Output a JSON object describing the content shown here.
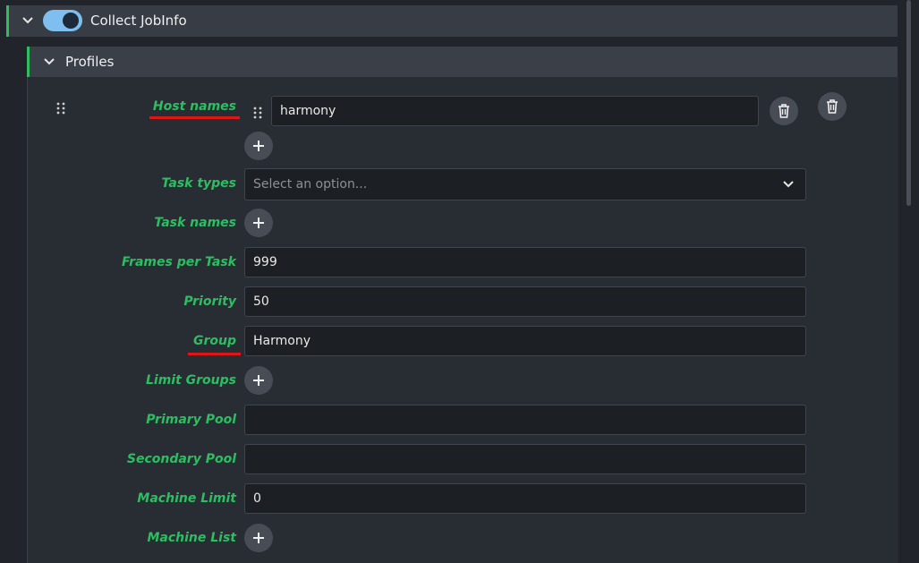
{
  "header": {
    "title": "Collect JobInfo",
    "enabled": true
  },
  "profiles": {
    "title": "Profiles"
  },
  "fields": {
    "host_names": {
      "label": "Host names",
      "items": [
        "harmony"
      ]
    },
    "task_types": {
      "label": "Task types",
      "placeholder": "Select an option..."
    },
    "task_names": {
      "label": "Task names"
    },
    "frames_per_task": {
      "label": "Frames per Task",
      "value": "999"
    },
    "priority": {
      "label": "Priority",
      "value": "50"
    },
    "group": {
      "label": "Group",
      "value": "Harmony"
    },
    "limit_groups": {
      "label": "Limit Groups"
    },
    "primary_pool": {
      "label": "Primary Pool",
      "value": ""
    },
    "secondary_pool": {
      "label": "Secondary Pool",
      "value": ""
    },
    "machine_limit": {
      "label": "Machine Limit",
      "value": "0"
    },
    "machine_list": {
      "label": "Machine List"
    }
  },
  "annotation_color": "#e01515",
  "accent_color": "#2fbe5c"
}
